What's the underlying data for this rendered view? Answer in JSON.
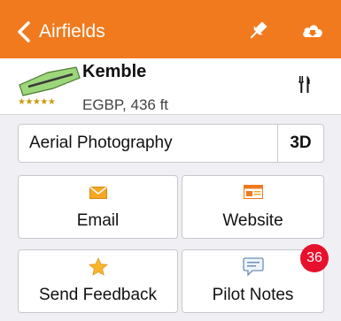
{
  "navbar": {
    "back_label": "Airfields",
    "background_color": "#f07a1d",
    "icons": [
      "chevron-left-icon",
      "pin-icon",
      "cloud-download-icon"
    ]
  },
  "airfield": {
    "name": "Kemble",
    "stars": "★★★★★",
    "details": "EGBP, 436 ft",
    "rating": 5,
    "icons": [
      "runway-icon",
      "restaurant-icon"
    ]
  },
  "aerial": {
    "label": "Aerial Photography",
    "mode_label": "3D"
  },
  "actions": {
    "email": {
      "label": "Email",
      "icon": "envelope-icon"
    },
    "website": {
      "label": "Website",
      "icon": "webpage-icon"
    },
    "feedback": {
      "label": "Send Feedback",
      "icon": "star-icon"
    },
    "notes": {
      "label": "Pilot Notes",
      "icon": "speech-bubble-icon",
      "badge": "36"
    }
  },
  "colors": {
    "accent": "#f07a1d",
    "badge": "#e8112d",
    "runway_green": "#9cd77a"
  }
}
